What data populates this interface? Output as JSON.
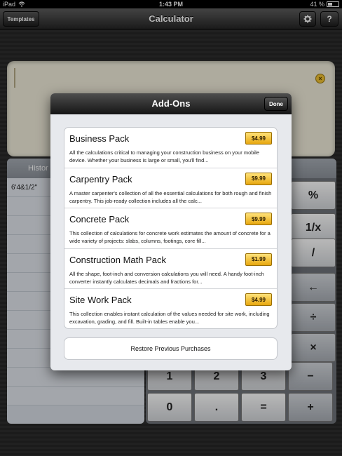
{
  "status_bar": {
    "device": "iPad",
    "wifi_icon": "wifi-icon",
    "time": "1:43 PM",
    "battery_text": "41 %",
    "battery_level": 0.41
  },
  "nav": {
    "title": "Calculator",
    "templates_label": "Templates",
    "gear_icon": "gear-icon",
    "help_label": "?"
  },
  "display": {
    "clear_icon": "×"
  },
  "history": {
    "header": "Histor",
    "rows": [
      "6'4&1/2\""
    ]
  },
  "keypad": {
    "keys": [
      "%",
      "1/x",
      "/",
      "←",
      "÷",
      "×",
      "1",
      "2",
      "3",
      "−",
      "0",
      ".",
      "=",
      "+"
    ]
  },
  "modal": {
    "title": "Add-Ons",
    "done_label": "Done",
    "items": [
      {
        "name": "Business Pack",
        "price": "$4.99",
        "description": "All the calculations critical to managing your construction business on your mobile device.  Whether your business is large or small, you'll find..."
      },
      {
        "name": "Carpentry Pack",
        "price": "$9.99",
        "description": "A master carpenter's collection of all the essential calculations for both rough and finish carpentry. This job-ready collection includes all the calc..."
      },
      {
        "name": "Concrete Pack",
        "price": "$9.99",
        "description": "This collection of calculations for concrete work estimates the amount of concrete for a wide variety of projects: slabs, columns, footings, core fill..."
      },
      {
        "name": "Construction Math Pack",
        "price": "$1.99",
        "description": "All the shape, foot-inch and conversion calculations you will need. A handy foot-inch converter instantly calculates decimals and fractions for..."
      },
      {
        "name": "Site Work Pack",
        "price": "$4.99",
        "description": "This collection enables instant calculation of the values needed for site work, including excavation, grading, and fill. Built-in tables enable you..."
      }
    ],
    "restore_label": "Restore Previous Purchases"
  }
}
